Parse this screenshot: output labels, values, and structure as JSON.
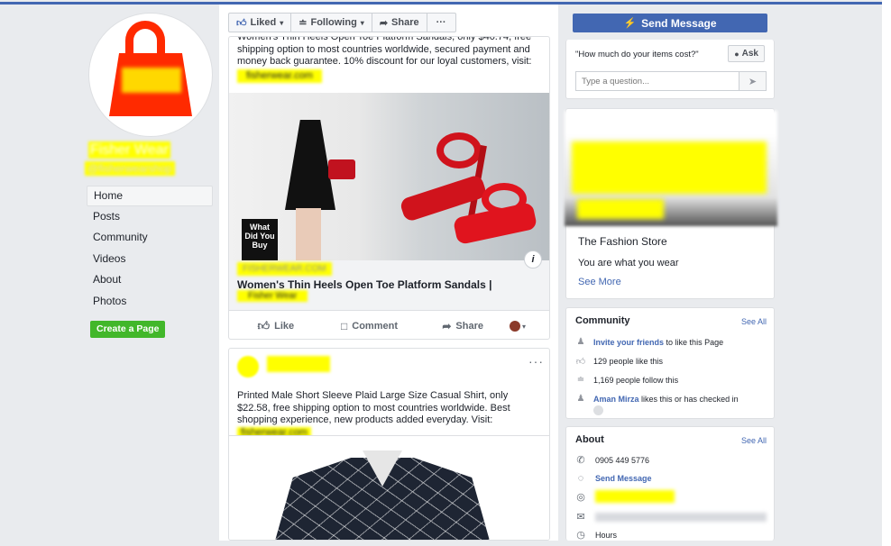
{
  "page": {
    "name": "Fisher Wear",
    "handle": "@fisherwearshop",
    "nav": [
      "Home",
      "Posts",
      "Community",
      "Videos",
      "About",
      "Photos"
    ],
    "active_nav": "Home",
    "create_page": "Create a Page"
  },
  "actions": {
    "liked": "Liked",
    "following": "Following",
    "share": "Share",
    "more": "···",
    "send_message": "Send Message"
  },
  "post1": {
    "text_line1": "Women's Thin Heels Open Toe Platform Sandals, only $40.74, free",
    "text_rest": "shipping option to most countries worldwide, secured payment and money back guarantee. 10% discount for our loyal customers, visit:",
    "link_hidden": "fisherwear.com",
    "image_overlay": "What Did You Buy",
    "info": "i",
    "preview_domain": "FISHERWEAR.COM",
    "preview_title": "Women's Thin Heels Open Toe Platform Sandals |",
    "preview_title_tail": "Fisher Wear",
    "like": "Like",
    "comment": "Comment",
    "share": "Share"
  },
  "post2": {
    "more": "···",
    "text": "Printed Male Short Sleeve Plaid Large Size Casual Shirt, only $22.58, free shipping option to most countries worldwide. Best shopping experience, new products added everyday. Visit:",
    "link_hidden": "fisherwear.com"
  },
  "ask": {
    "question": "\"How much do your items cost?\"",
    "ask_label": "Ask",
    "placeholder": "Type a question..."
  },
  "store": {
    "name": "The Fashion Store",
    "tagline": "You are what you wear",
    "see_more": "See More"
  },
  "community": {
    "title": "Community",
    "see_all": "See All",
    "invite_link": "Invite your friends",
    "invite_rest": "to like this Page",
    "likes": "129 people like this",
    "follows": "1,169 people follow this",
    "friend_name": "Aman Mirza",
    "friend_rest": "likes this or has checked in"
  },
  "about": {
    "title": "About",
    "see_all": "See All",
    "phone": "0905 449 5776",
    "send_message": "Send Message",
    "hours": "Hours"
  },
  "colors": {
    "brand": "#4267b2",
    "green": "#42b72a",
    "highlight": "#ffff00",
    "bag_red": "#ff2a00"
  }
}
